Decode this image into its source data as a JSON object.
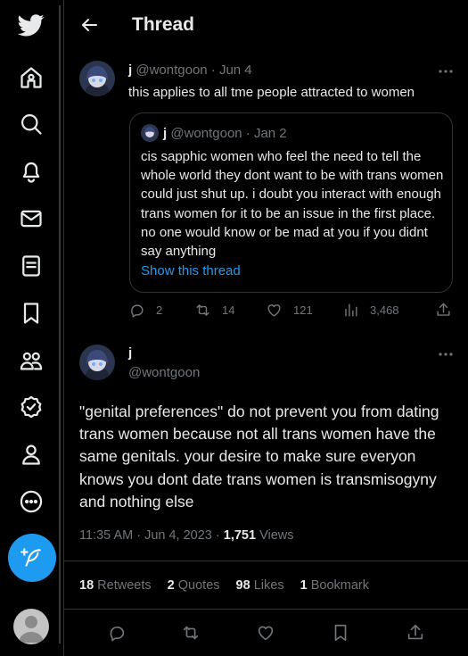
{
  "app": {
    "brand": "twitter-logo",
    "accent_color": "#1d9bf0"
  },
  "header": {
    "title": "Thread"
  },
  "nav_icons": [
    "home-icon",
    "explore-icon",
    "notifications-icon",
    "messages-icon",
    "lists-icon",
    "bookmarks-icon",
    "communities-icon",
    "verified-icon",
    "profile-icon",
    "more-icon"
  ],
  "tweet1": {
    "display_name": "j",
    "handle_date": "@wontgoon · Jun 4",
    "text": "this applies to all tme people attracted to women",
    "quote": {
      "display_name": "j",
      "handle_date": "@wontgoon · Jan 2",
      "text": "cis sapphic women who feel the need to tell the whole world they dont want to be with trans women could just shut up. i doubt you interact with enough trans women for it to be an issue in the first place. no one would know or be mad at you if you didnt say anything",
      "link": "Show this thread"
    },
    "replies": "2",
    "retweets": "14",
    "likes": "121",
    "views": "3,468"
  },
  "tweet2": {
    "display_name": "j",
    "handle": "@wontgoon",
    "text": "\"genital preferences\" do not prevent you from dating trans women because not all trans women have the same genitals. your desire to make sure everyon knows you dont date trans women is transmisogyny and nothing else",
    "timestamp": "11:35 AM · Jun 4, 2023 · ",
    "views_count": "1,751",
    "views_label": " Views",
    "retweets_count": "18",
    "retweets_label": " Retweets",
    "quotes_count": "2",
    "quotes_label": " Quotes",
    "likes_count": "98",
    "likes_label": " Likes",
    "bookmarks_count": "1",
    "bookmarks_label": " Bookmark"
  }
}
